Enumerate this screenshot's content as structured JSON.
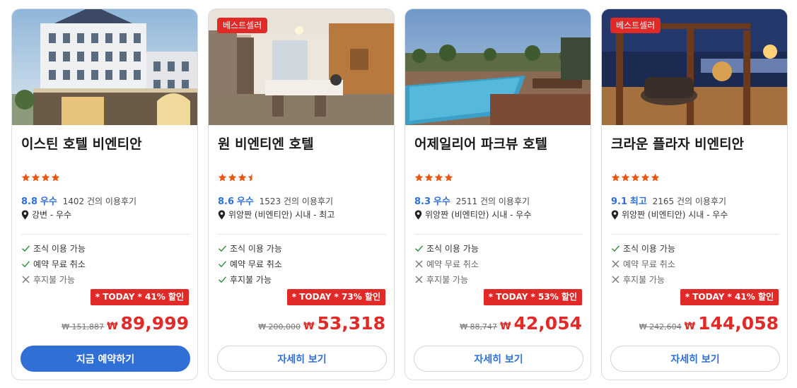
{
  "hotels": [
    {
      "name": "이스틴 호텔 비엔티안",
      "badge": "",
      "stars": 4,
      "score": "8.8",
      "score_word": "우수",
      "reviews": "1402 건의 이용후기",
      "location": "강변 - 우수",
      "features": [
        {
          "label": "조식 이용 가능",
          "available": true
        },
        {
          "label": "예약 무료 취소",
          "available": true
        },
        {
          "label": "후지불 가능",
          "available": false
        }
      ],
      "discount": "* TODAY * 41% 할인",
      "old_price": "₩ 151,887",
      "currency": "₩",
      "price": "89,999",
      "button": "지금 예약하기",
      "button_primary": true
    },
    {
      "name": "원 비엔티엔 호텔",
      "badge": "베스트셀러",
      "stars": 3.5,
      "score": "8.6",
      "score_word": "우수",
      "reviews": "1523 건의 이용후기",
      "location": "위앙짠 (비엔티안) 시내 - 최고",
      "features": [
        {
          "label": "조식 이용 가능",
          "available": true
        },
        {
          "label": "예약 무료 취소",
          "available": true
        },
        {
          "label": "후지불 가능",
          "available": true
        }
      ],
      "discount": "* TODAY * 73% 할인",
      "old_price": "₩ 200,000",
      "currency": "₩",
      "price": "53,318",
      "button": "자세히 보기",
      "button_primary": false
    },
    {
      "name": "어제일리어 파크뷰 호텔",
      "badge": "",
      "stars": 4,
      "score": "8.3",
      "score_word": "우수",
      "reviews": "2511 건의 이용후기",
      "location": "위앙짠 (비엔티안) 시내 - 우수",
      "features": [
        {
          "label": "조식 이용 가능",
          "available": true
        },
        {
          "label": "예약 무료 취소",
          "available": false
        },
        {
          "label": "후지불 가능",
          "available": false
        }
      ],
      "discount": "* TODAY * 53% 할인",
      "old_price": "₩ 88,747",
      "currency": "₩",
      "price": "42,054",
      "button": "자세히 보기",
      "button_primary": false
    },
    {
      "name": "크라운 플라자 비엔티안",
      "badge": "베스트셀러",
      "stars": 5,
      "score": "9.1",
      "score_word": "최고",
      "reviews": "2165 건의 이용후기",
      "location": "위앙짠 (비엔티안) 시내 - 우수",
      "features": [
        {
          "label": "조식 이용 가능",
          "available": true
        },
        {
          "label": "예약 무료 취소",
          "available": false
        },
        {
          "label": "후지불 가능",
          "available": false
        }
      ],
      "discount": "* TODAY * 41% 할인",
      "old_price": "₩ 242,604",
      "currency": "₩",
      "price": "144,058",
      "button": "자세히 보기",
      "button_primary": false
    }
  ],
  "colors": {
    "accent_blue": "#2f6fd6",
    "discount_red": "#e12a27",
    "star_orange": "#e8550f",
    "check_green": "#2e8b3a"
  }
}
